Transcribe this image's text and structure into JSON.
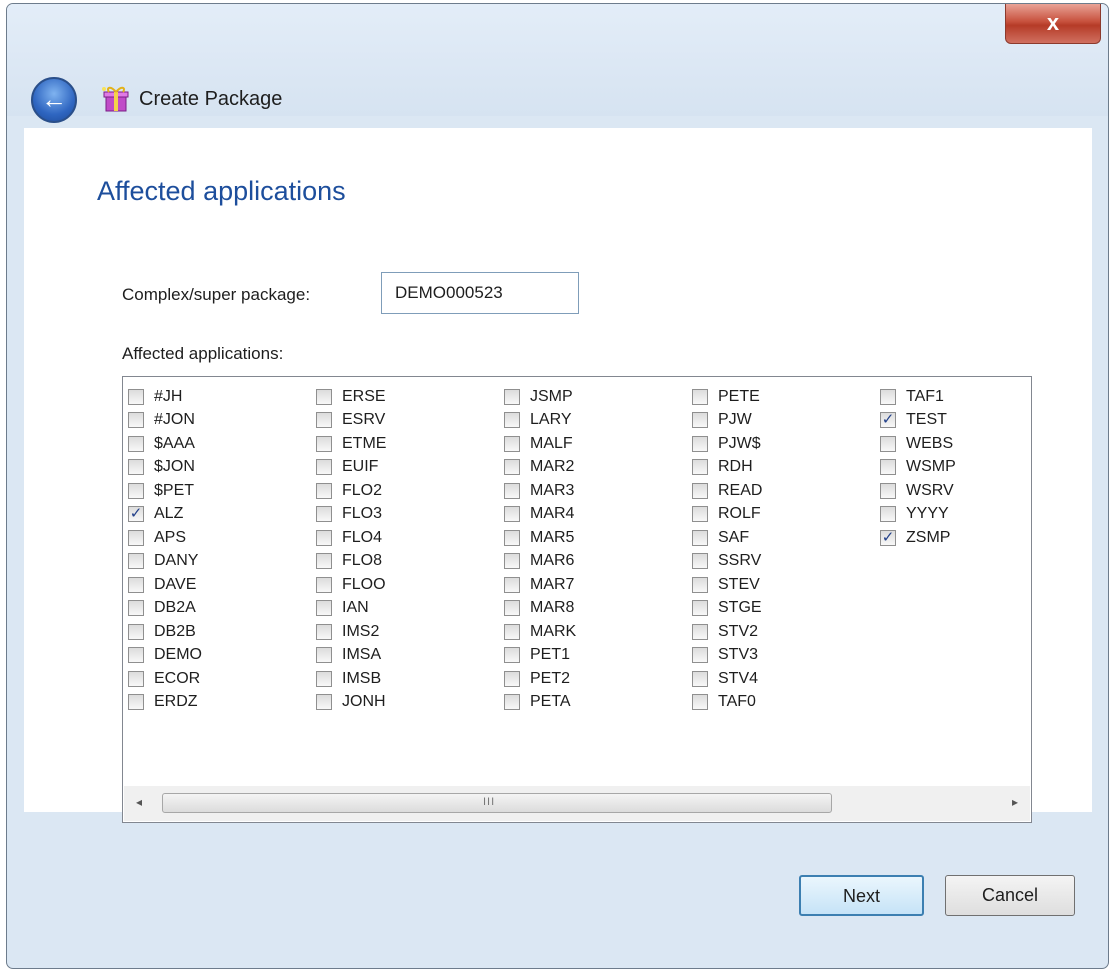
{
  "window": {
    "close_label": "x",
    "header_title": "Create Package",
    "icons": {
      "back": "back-arrow-icon",
      "package": "package-icon",
      "close": "close-icon"
    }
  },
  "page": {
    "title": "Affected applications",
    "package_label": "Complex/super package:",
    "package_value": "DEMO000523",
    "list_label": "Affected applications:"
  },
  "columns": [
    [
      {
        "label": "#JH",
        "checked": false
      },
      {
        "label": "#JON",
        "checked": false
      },
      {
        "label": "$AAA",
        "checked": false
      },
      {
        "label": "$JON",
        "checked": false
      },
      {
        "label": "$PET",
        "checked": false
      },
      {
        "label": "ALZ",
        "checked": true
      },
      {
        "label": "APS",
        "checked": false
      },
      {
        "label": "DANY",
        "checked": false
      },
      {
        "label": "DAVE",
        "checked": false
      },
      {
        "label": "DB2A",
        "checked": false
      },
      {
        "label": "DB2B",
        "checked": false
      },
      {
        "label": "DEMO",
        "checked": false
      },
      {
        "label": "ECOR",
        "checked": false
      },
      {
        "label": "ERDZ",
        "checked": false
      }
    ],
    [
      {
        "label": "ERSE",
        "checked": false
      },
      {
        "label": "ESRV",
        "checked": false
      },
      {
        "label": "ETME",
        "checked": false
      },
      {
        "label": "EUIF",
        "checked": false
      },
      {
        "label": "FLO2",
        "checked": false
      },
      {
        "label": "FLO3",
        "checked": false
      },
      {
        "label": "FLO4",
        "checked": false
      },
      {
        "label": "FLO8",
        "checked": false
      },
      {
        "label": "FLOO",
        "checked": false
      },
      {
        "label": "IAN",
        "checked": false
      },
      {
        "label": "IMS2",
        "checked": false
      },
      {
        "label": "IMSA",
        "checked": false
      },
      {
        "label": "IMSB",
        "checked": false
      },
      {
        "label": "JONH",
        "checked": false
      }
    ],
    [
      {
        "label": "JSMP",
        "checked": false
      },
      {
        "label": "LARY",
        "checked": false
      },
      {
        "label": "MALF",
        "checked": false
      },
      {
        "label": "MAR2",
        "checked": false
      },
      {
        "label": "MAR3",
        "checked": false
      },
      {
        "label": "MAR4",
        "checked": false
      },
      {
        "label": "MAR5",
        "checked": false
      },
      {
        "label": "MAR6",
        "checked": false
      },
      {
        "label": "MAR7",
        "checked": false
      },
      {
        "label": "MAR8",
        "checked": false
      },
      {
        "label": "MARK",
        "checked": false
      },
      {
        "label": "PET1",
        "checked": false
      },
      {
        "label": "PET2",
        "checked": false
      },
      {
        "label": "PETA",
        "checked": false
      }
    ],
    [
      {
        "label": "PETE",
        "checked": false
      },
      {
        "label": "PJW",
        "checked": false
      },
      {
        "label": "PJW$",
        "checked": false
      },
      {
        "label": "RDH",
        "checked": false
      },
      {
        "label": "READ",
        "checked": false
      },
      {
        "label": "ROLF",
        "checked": false
      },
      {
        "label": "SAF",
        "checked": false
      },
      {
        "label": "SSRV",
        "checked": false
      },
      {
        "label": "STEV",
        "checked": false
      },
      {
        "label": "STGE",
        "checked": false
      },
      {
        "label": "STV2",
        "checked": false
      },
      {
        "label": "STV3",
        "checked": false
      },
      {
        "label": "STV4",
        "checked": false
      },
      {
        "label": "TAF0",
        "checked": false
      }
    ],
    [
      {
        "label": "TAF1",
        "checked": false
      },
      {
        "label": "TEST",
        "checked": true
      },
      {
        "label": "WEBS",
        "checked": false
      },
      {
        "label": "WSMP",
        "checked": false
      },
      {
        "label": "WSRV",
        "checked": false
      },
      {
        "label": "YYYY",
        "checked": false
      },
      {
        "label": "ZSMP",
        "checked": true
      }
    ]
  ],
  "scrollbar": {
    "left_arrow": "◂",
    "right_arrow": "▸",
    "grip": "III"
  },
  "buttons": {
    "next": "Next",
    "cancel": "Cancel"
  }
}
